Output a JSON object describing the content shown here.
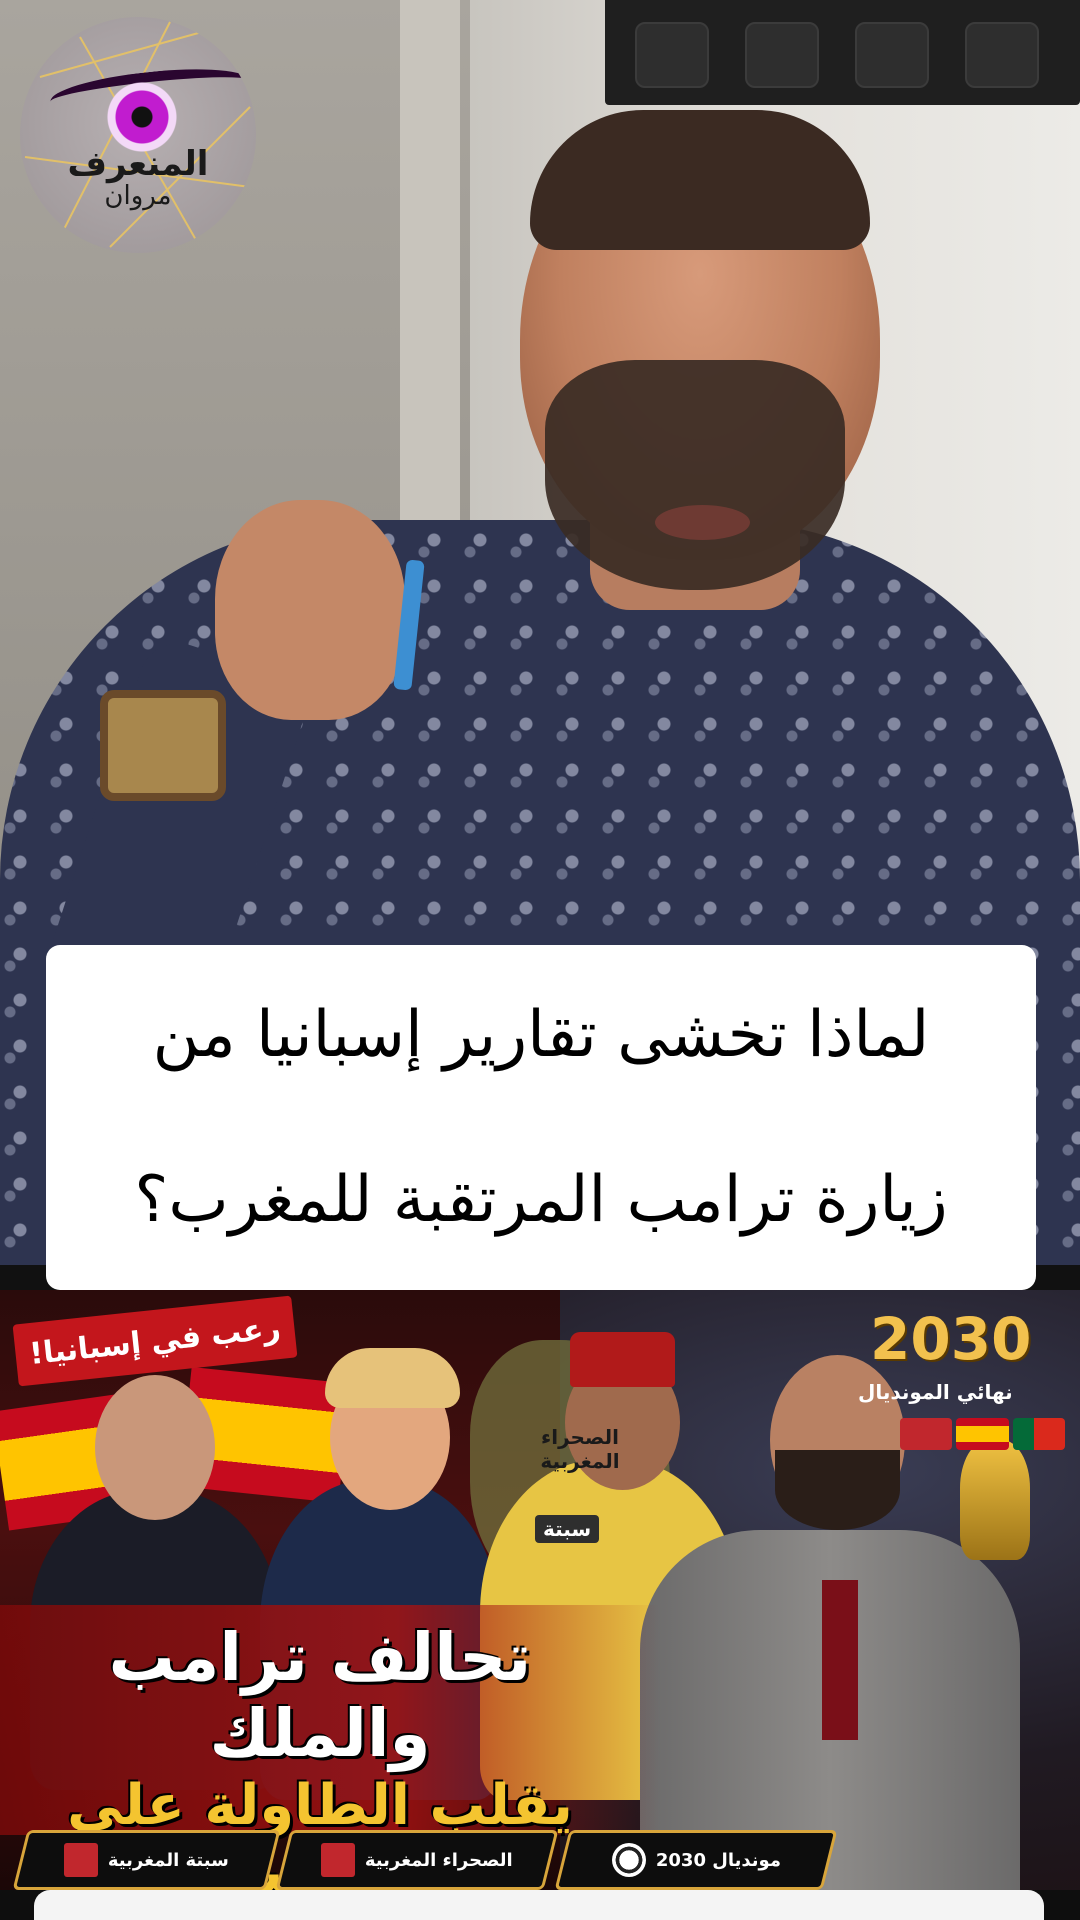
{
  "logo": {
    "title": "المنعرف",
    "subtitle": "مروان"
  },
  "caption": {
    "line1": "لماذا تخشى تقارير إسبانيا من",
    "line2": "زيارة ترامب المرتقبة للمغرب؟"
  },
  "thumbnail": {
    "year": "2030",
    "final_label": "نهائي المونديال",
    "fear_tag": "رعب في إسبانيا!",
    "map_label": "الصحراء المغربية",
    "city_label": "سبتة",
    "headline_1": "تحالف ترامب والملك",
    "headline_2": "يقلب الطاولة على إسبانيا!",
    "chips": [
      {
        "label": "مونديال 2030",
        "icon": "football-icon"
      },
      {
        "label": "الصحراء المغربية",
        "icon": "morocco-flag-icon"
      },
      {
        "label": "سبتة المغربية",
        "icon": "morocco-flag-icon"
      }
    ],
    "colors": {
      "gold": "#f4c430",
      "red": "#c3161c",
      "morocco_red": "#c1272d",
      "spain_yellow": "#ffc400",
      "portugal_green": "#046a38"
    }
  }
}
